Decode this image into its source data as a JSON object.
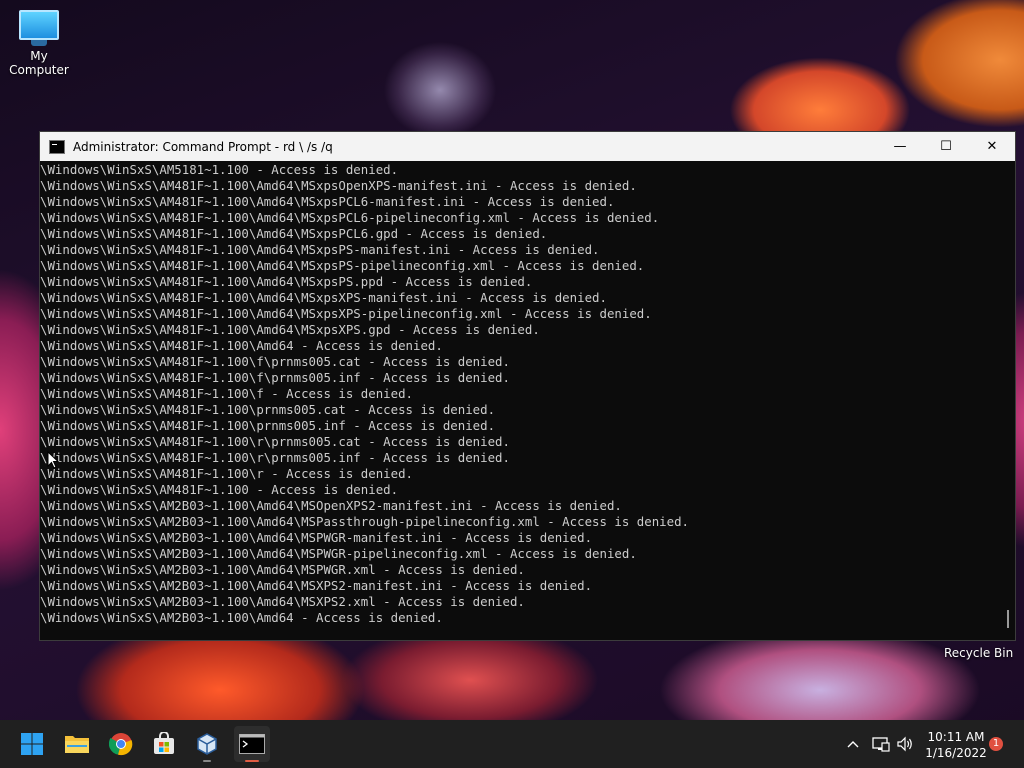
{
  "desktop": {
    "my_computer_label": "My Computer",
    "recycle_bin_label": "Recycle Bin"
  },
  "window": {
    "title": "Administrator: Command Prompt - rd \\ /s /q",
    "minimize": "—",
    "maximize": "☐",
    "close": "✕"
  },
  "console": {
    "lines": [
      "\\Windows\\WinSxS\\AM5181~1.100 - Access is denied.",
      "\\Windows\\WinSxS\\AM481F~1.100\\Amd64\\MSxpsOpenXPS-manifest.ini - Access is denied.",
      "\\Windows\\WinSxS\\AM481F~1.100\\Amd64\\MSxpsPCL6-manifest.ini - Access is denied.",
      "\\Windows\\WinSxS\\AM481F~1.100\\Amd64\\MSxpsPCL6-pipelineconfig.xml - Access is denied.",
      "\\Windows\\WinSxS\\AM481F~1.100\\Amd64\\MSxpsPCL6.gpd - Access is denied.",
      "\\Windows\\WinSxS\\AM481F~1.100\\Amd64\\MSxpsPS-manifest.ini - Access is denied.",
      "\\Windows\\WinSxS\\AM481F~1.100\\Amd64\\MSxpsPS-pipelineconfig.xml - Access is denied.",
      "\\Windows\\WinSxS\\AM481F~1.100\\Amd64\\MSxpsPS.ppd - Access is denied.",
      "\\Windows\\WinSxS\\AM481F~1.100\\Amd64\\MSxpsXPS-manifest.ini - Access is denied.",
      "\\Windows\\WinSxS\\AM481F~1.100\\Amd64\\MSxpsXPS-pipelineconfig.xml - Access is denied.",
      "\\Windows\\WinSxS\\AM481F~1.100\\Amd64\\MSxpsXPS.gpd - Access is denied.",
      "\\Windows\\WinSxS\\AM481F~1.100\\Amd64 - Access is denied.",
      "\\Windows\\WinSxS\\AM481F~1.100\\f\\prnms005.cat - Access is denied.",
      "\\Windows\\WinSxS\\AM481F~1.100\\f\\prnms005.inf - Access is denied.",
      "\\Windows\\WinSxS\\AM481F~1.100\\f - Access is denied.",
      "\\Windows\\WinSxS\\AM481F~1.100\\prnms005.cat - Access is denied.",
      "\\Windows\\WinSxS\\AM481F~1.100\\prnms005.inf - Access is denied.",
      "\\Windows\\WinSxS\\AM481F~1.100\\r\\prnms005.cat - Access is denied.",
      "\\Windows\\WinSxS\\AM481F~1.100\\r\\prnms005.inf - Access is denied.",
      "\\Windows\\WinSxS\\AM481F~1.100\\r - Access is denied.",
      "\\Windows\\WinSxS\\AM481F~1.100 - Access is denied.",
      "\\Windows\\WinSxS\\AM2B03~1.100\\Amd64\\MSOpenXPS2-manifest.ini - Access is denied.",
      "\\Windows\\WinSxS\\AM2B03~1.100\\Amd64\\MSPassthrough-pipelineconfig.xml - Access is denied.",
      "\\Windows\\WinSxS\\AM2B03~1.100\\Amd64\\MSPWGR-manifest.ini - Access is denied.",
      "\\Windows\\WinSxS\\AM2B03~1.100\\Amd64\\MSPWGR-pipelineconfig.xml - Access is denied.",
      "\\Windows\\WinSxS\\AM2B03~1.100\\Amd64\\MSPWGR.xml - Access is denied.",
      "\\Windows\\WinSxS\\AM2B03~1.100\\Amd64\\MSXPS2-manifest.ini - Access is denied.",
      "\\Windows\\WinSxS\\AM2B03~1.100\\Amd64\\MSXPS2.xml - Access is denied.",
      "\\Windows\\WinSxS\\AM2B03~1.100\\Amd64 - Access is denied."
    ]
  },
  "taskbar": {
    "apps": [
      "start-icon",
      "file-explorer-icon",
      "chrome-icon",
      "store-icon",
      "virtualbox-icon",
      "terminal-icon"
    ],
    "tray_chevron": "^",
    "clock_time": "10:11 AM",
    "clock_date": "1/16/2022",
    "notification_count": "1"
  },
  "colors": {
    "console_bg": "#0c0c0c",
    "console_text": "#cccccc",
    "taskbar_bg": "#202020",
    "active_indicator": "#e05d44"
  }
}
